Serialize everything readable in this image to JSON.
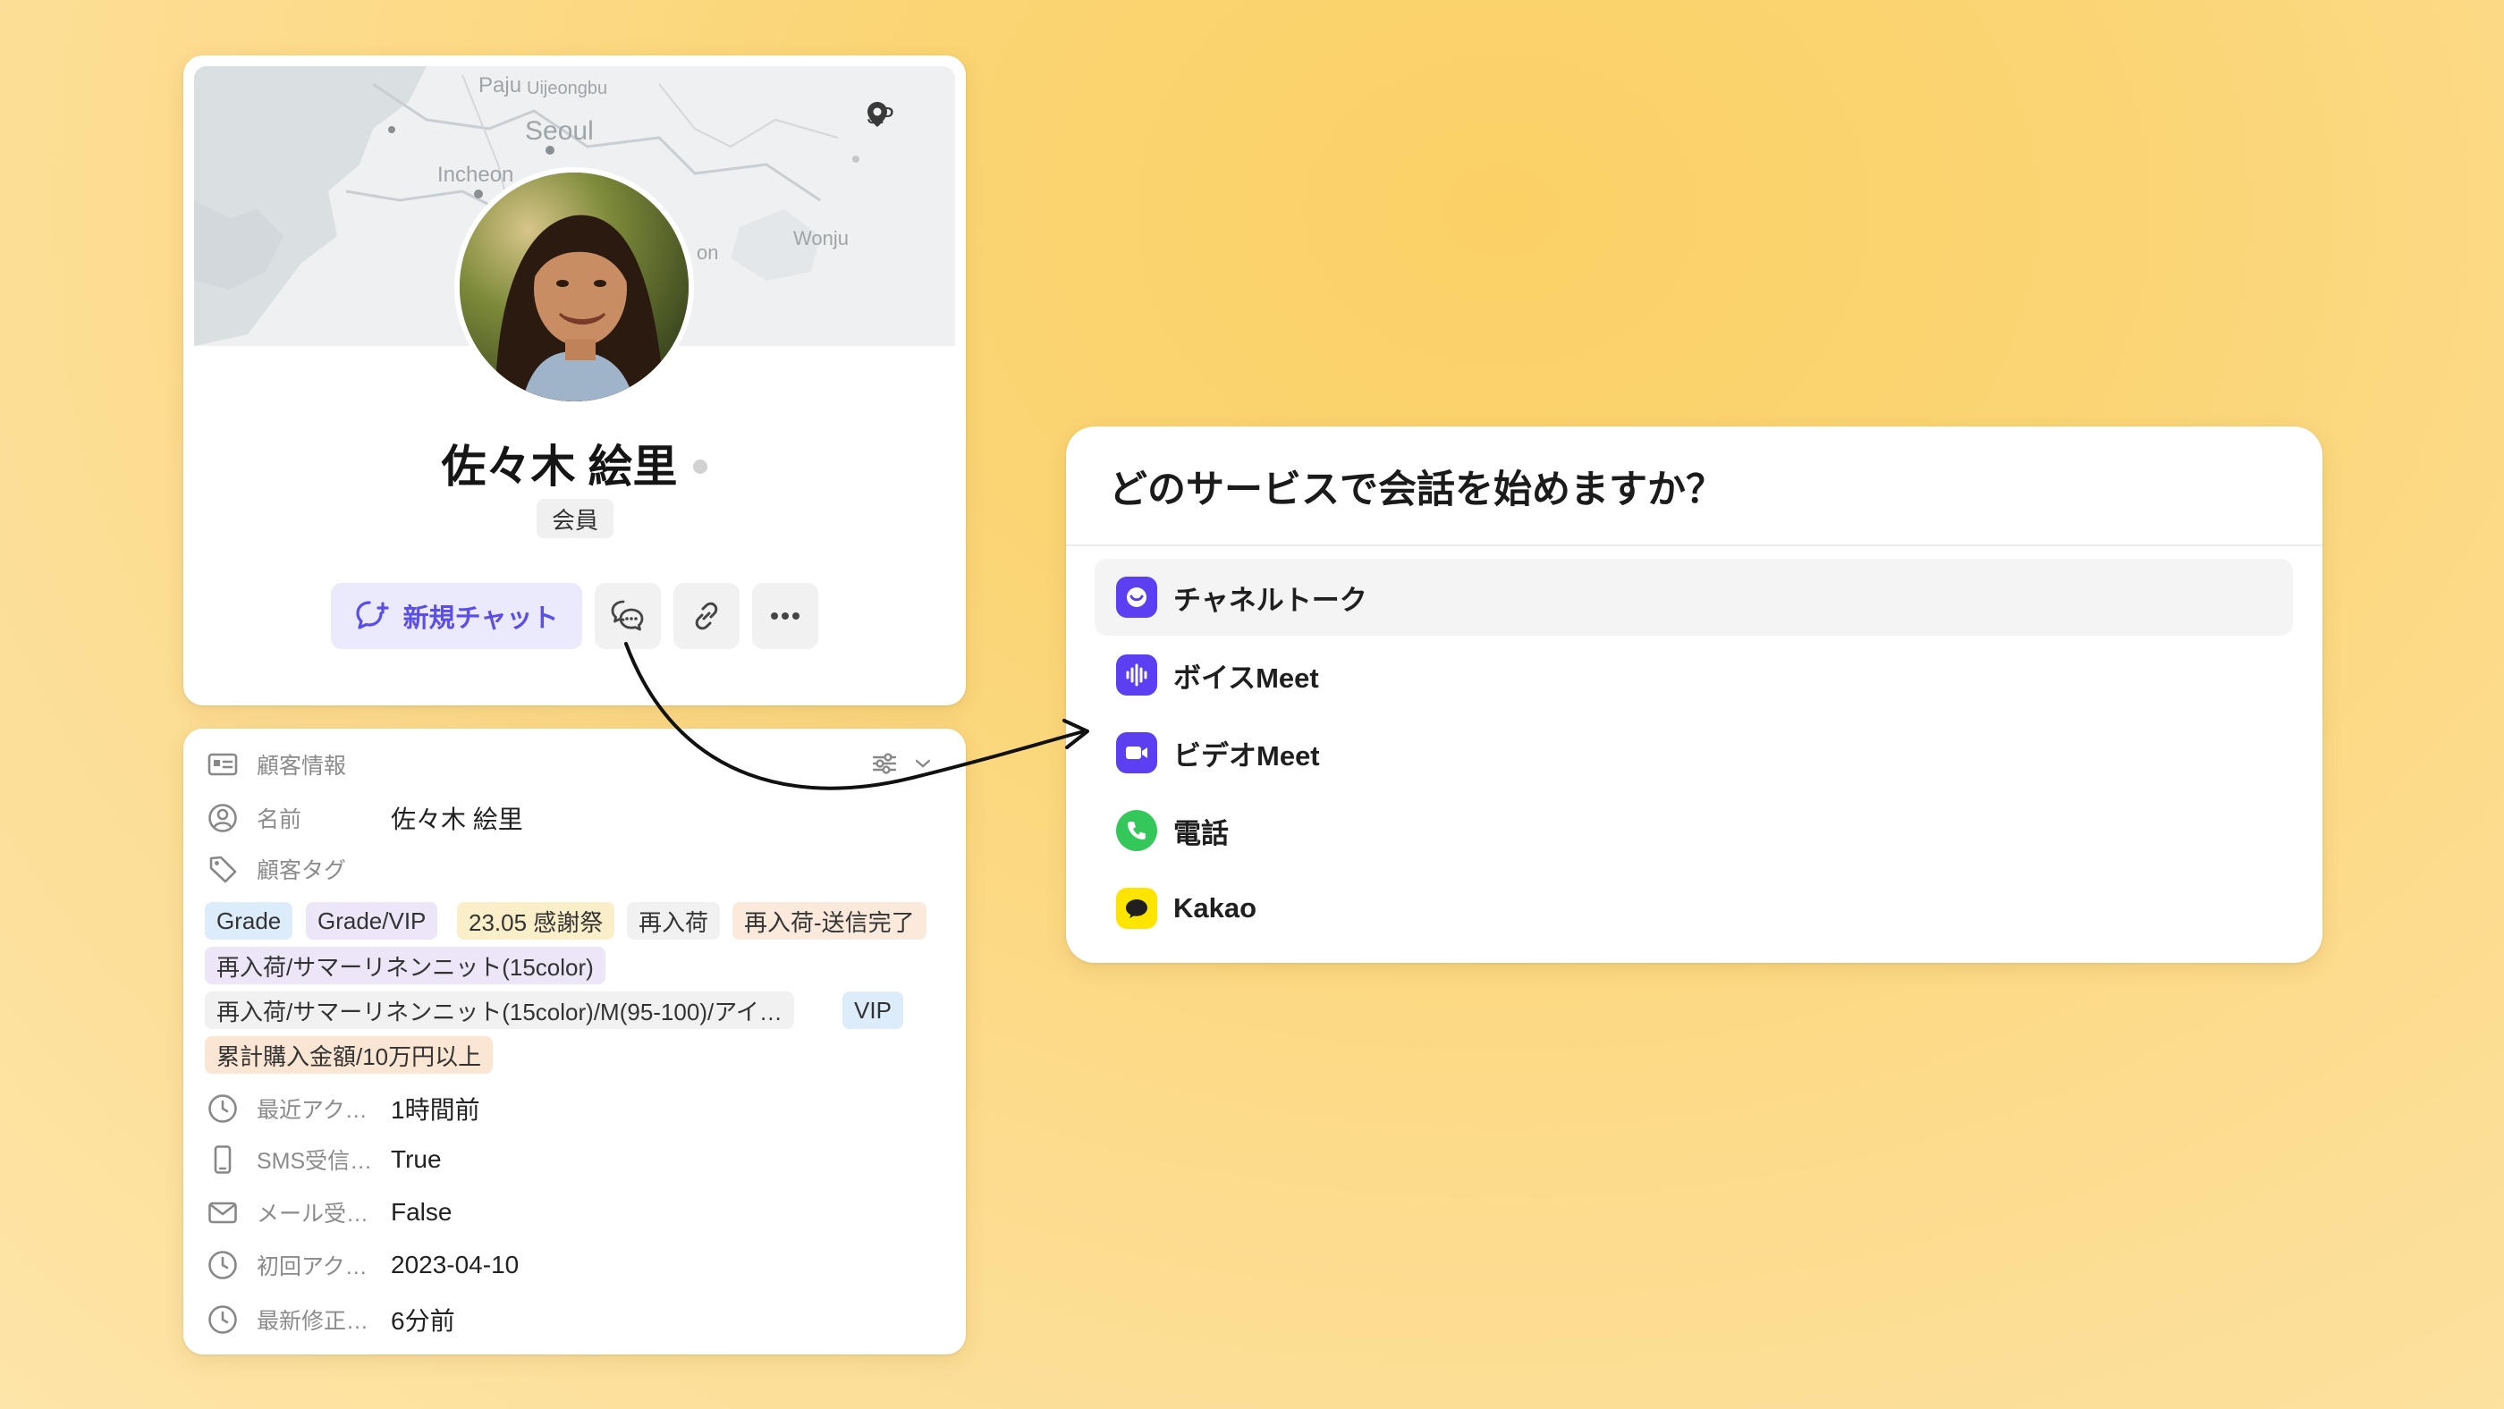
{
  "profile": {
    "map_labels": [
      "Paju",
      "Uijeongbu",
      "Seoul",
      "Incheon",
      "Wonju",
      "on"
    ],
    "location": "JP",
    "name": "佐々木 絵里",
    "badge": "会員",
    "new_chat_label": "新規チャット"
  },
  "info": {
    "section_title": "顧客情報",
    "name_label": "名前",
    "name_value": "佐々木 絵里",
    "tags_label": "顧客タグ",
    "tags": [
      {
        "text": "Grade",
        "color": "#dcecfa"
      },
      {
        "text": "Grade/VIP",
        "color": "#ece6f8"
      },
      {
        "text": "23.05 感謝祭",
        "color": "#fbefc9"
      },
      {
        "text": "再入荷",
        "color": "#f1f1f1"
      },
      {
        "text": "再入荷-送信完了",
        "color": "#fbeadb"
      },
      {
        "text": "再入荷/サマーリネンニット(15color)",
        "color": "#ece6f8"
      },
      {
        "text": "再入荷/サマーリネンニット(15color)/M(95-100)/アイ…",
        "color": "#f1f1f1"
      },
      {
        "text": "VIP",
        "color": "#dcecfa"
      },
      {
        "text": "累計購入金額/10万円以上",
        "color": "#fbe6d4"
      }
    ],
    "rows": [
      {
        "label": "最近アク…",
        "value": "1時間前",
        "icon": "clock-icon"
      },
      {
        "label": "SMS受信…",
        "value": "True",
        "icon": "phone-icon"
      },
      {
        "label": "メール受…",
        "value": "False",
        "icon": "mail-icon"
      },
      {
        "label": "初回アク…",
        "value": "2023-04-10",
        "icon": "clock-icon"
      },
      {
        "label": "最新修正…",
        "value": "6分前",
        "icon": "clock-icon"
      }
    ]
  },
  "service": {
    "title": "どのサービスで会話を始めますか？",
    "items": [
      {
        "label": "チャネルトーク",
        "icon": "channel-talk-icon",
        "color": "#5b3ff0"
      },
      {
        "label": "ボイスMeet",
        "icon": "voice-icon",
        "color": "#5b3ff0"
      },
      {
        "label": "ビデオMeet",
        "icon": "video-icon",
        "color": "#5b3ff0"
      },
      {
        "label": "電話",
        "icon": "phone-call-icon",
        "color": "#34c759"
      },
      {
        "label": "Kakao",
        "icon": "kakao-icon",
        "color": "#fee500"
      }
    ]
  }
}
